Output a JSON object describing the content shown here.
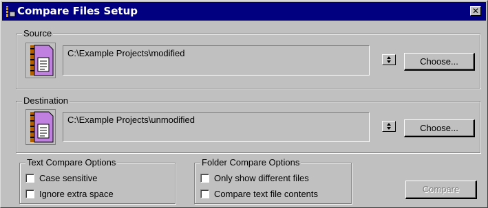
{
  "window": {
    "title": "Compare Files Setup",
    "close_label": "✕"
  },
  "source": {
    "label": "Source",
    "path": "C:\\Example Projects\\modified",
    "choose_label": "Choose..."
  },
  "destination": {
    "label": "Destination",
    "path": "C:\\Example Projects\\unmodified",
    "choose_label": "Choose..."
  },
  "text_options": {
    "label": "Text Compare Options",
    "items": [
      {
        "label": "Case sensitive",
        "checked": false
      },
      {
        "label": "Ignore extra space",
        "checked": false
      }
    ]
  },
  "folder_options": {
    "label": "Folder Compare Options",
    "items": [
      {
        "label": "Only show different files",
        "checked": false
      },
      {
        "label": "Compare text file contents",
        "checked": false
      }
    ]
  },
  "compare_button": {
    "label": "Compare",
    "enabled": false
  },
  "colors": {
    "titlebar": "#000080",
    "face": "#c0c0c0",
    "shadow": "#808080",
    "highlight": "#ffffff"
  }
}
